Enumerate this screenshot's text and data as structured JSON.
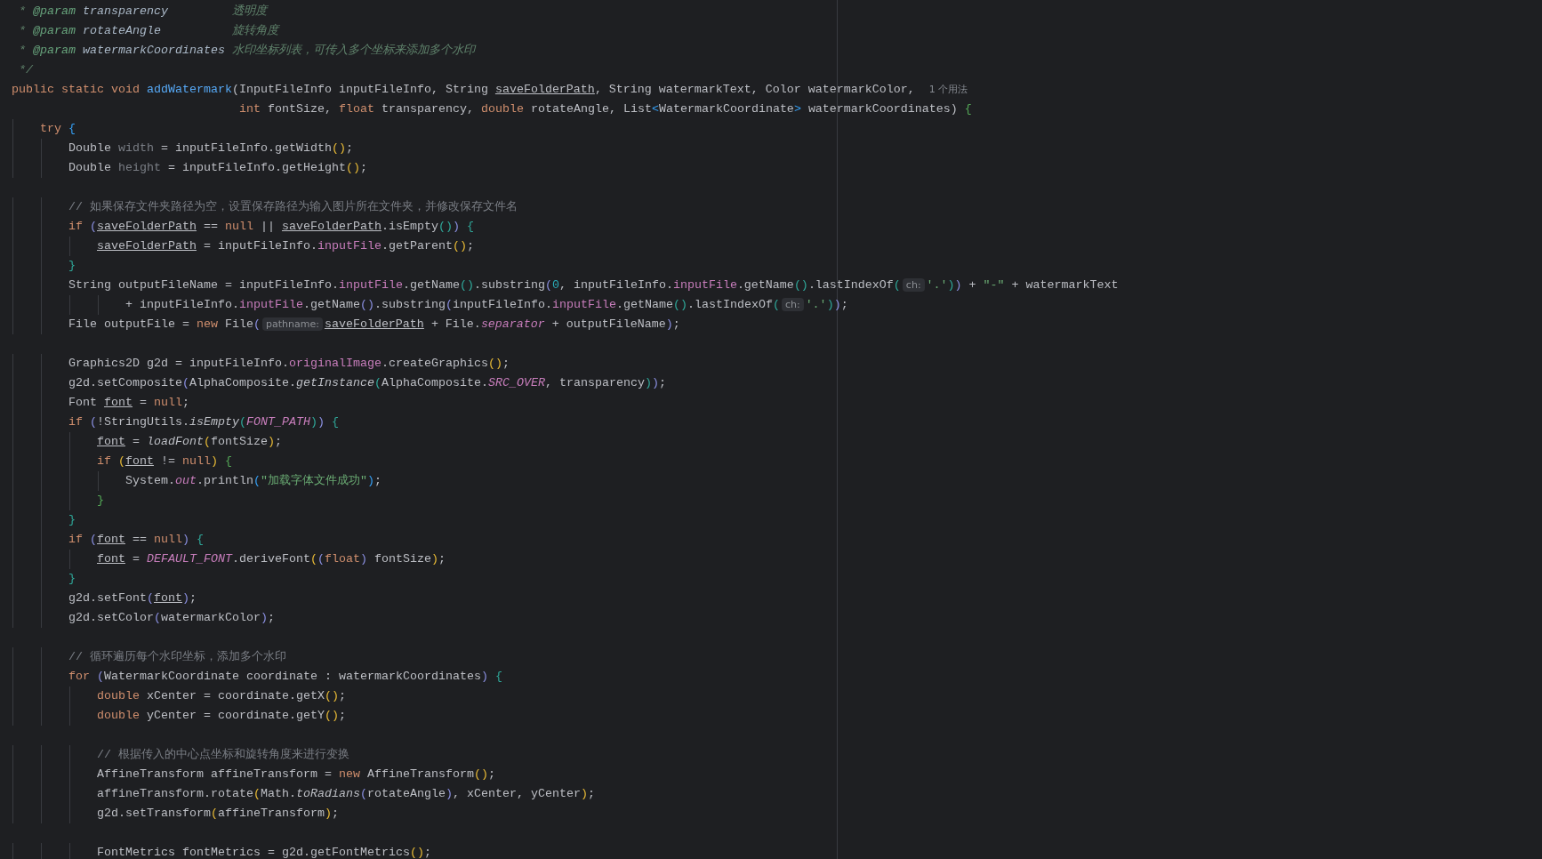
{
  "editor": {
    "lines": [
      {
        "tokens": [
          {
            "kind": "doc",
            "text": " * "
          },
          {
            "kind": "dtag",
            "text": "@param"
          },
          {
            "kind": "dparam",
            "text": " transparency         "
          },
          {
            "kind": "doc",
            "text": "透明度"
          }
        ]
      },
      {
        "tokens": [
          {
            "kind": "doc",
            "text": " * "
          },
          {
            "kind": "dtag",
            "text": "@param"
          },
          {
            "kind": "dparam",
            "text": " rotateAngle          "
          },
          {
            "kind": "doc",
            "text": "旋转角度"
          }
        ]
      },
      {
        "tokens": [
          {
            "kind": "doc",
            "text": " * "
          },
          {
            "kind": "dtag",
            "text": "@param"
          },
          {
            "kind": "dparam",
            "text": " watermarkCoordinates "
          },
          {
            "kind": "doc",
            "text": "水印坐标列表，可传入多个坐标来添加多个水印"
          }
        ]
      },
      {
        "tokens": [
          {
            "kind": "doc",
            "text": " */"
          }
        ]
      },
      {
        "tokens": [
          {
            "kind": "kw",
            "text": "public static void "
          },
          {
            "kind": "decl",
            "text": "addWatermark"
          },
          {
            "kind": "p",
            "text": "(InputFileInfo inputFileInfo, String "
          },
          {
            "kind": "ul",
            "text": "saveFolderPath"
          },
          {
            "kind": "p",
            "text": ", String watermarkText, Color watermarkColor,  "
          },
          {
            "kind": "usage",
            "text": "1 个用法"
          }
        ]
      },
      {
        "tokens": [
          {
            "kind": "kw",
            "text": "                                int"
          },
          {
            "kind": "p",
            "text": " fontSize, "
          },
          {
            "kind": "kw",
            "text": "float"
          },
          {
            "kind": "p",
            "text": " transparency, "
          },
          {
            "kind": "kw",
            "text": "double"
          },
          {
            "kind": "p",
            "text": " rotateAngle, List"
          },
          {
            "kind": "br5",
            "text": "<"
          },
          {
            "kind": "p",
            "text": "WatermarkCoordinate"
          },
          {
            "kind": "br5",
            "text": ">"
          },
          {
            "kind": "p",
            "text": " watermarkCoordinates) "
          },
          {
            "kind": "br4",
            "text": "{"
          }
        ]
      },
      {
        "tokens": [
          {
            "kind": "kw",
            "text": "    try "
          },
          {
            "kind": "br5",
            "text": "{"
          }
        ]
      },
      {
        "tokens": [
          {
            "kind": "p",
            "text": "        Double "
          },
          {
            "kind": "unused",
            "text": "width"
          },
          {
            "kind": "p",
            "text": " = inputFileInfo.getWidth"
          },
          {
            "kind": "br1",
            "text": "()"
          },
          {
            "kind": "p",
            "text": ";"
          }
        ]
      },
      {
        "tokens": [
          {
            "kind": "p",
            "text": "        Double "
          },
          {
            "kind": "unused",
            "text": "height"
          },
          {
            "kind": "p",
            "text": " = inputFileInfo.getHeight"
          },
          {
            "kind": "br1",
            "text": "()"
          },
          {
            "kind": "p",
            "text": ";"
          }
        ]
      },
      {
        "blank_before": true,
        "tokens": [
          {
            "kind": "cm",
            "text": "        // 如果保存文件夹路径为空，设置保存路径为输入图片所在文件夹，并修改保存文件名"
          }
        ]
      },
      {
        "tokens": [
          {
            "kind": "kw",
            "text": "        if "
          },
          {
            "kind": "br3",
            "text": "("
          },
          {
            "kind": "ul",
            "text": "saveFolderPath"
          },
          {
            "kind": "p",
            "text": " == "
          },
          {
            "kind": "kw",
            "text": "null"
          },
          {
            "kind": "p",
            "text": " || "
          },
          {
            "kind": "ul",
            "text": "saveFolderPath"
          },
          {
            "kind": "p",
            "text": ".isEmpty"
          },
          {
            "kind": "br2",
            "text": "()"
          },
          {
            "kind": "br3",
            "text": ")"
          },
          {
            "kind": "br2",
            "text": " {"
          }
        ]
      },
      {
        "tokens": [
          {
            "kind": "ul",
            "text": "            saveFolderPath"
          },
          {
            "kind": "p",
            "text": " = inputFileInfo."
          },
          {
            "kind": "fld",
            "text": "inputFile"
          },
          {
            "kind": "p",
            "text": ".getParent"
          },
          {
            "kind": "br1",
            "text": "()"
          },
          {
            "kind": "p",
            "text": ";"
          }
        ]
      },
      {
        "tokens": [
          {
            "kind": "br2",
            "text": "        }"
          }
        ]
      },
      {
        "tokens": [
          {
            "kind": "p",
            "text": "        String outputFileName = inputFileInfo."
          },
          {
            "kind": "fld",
            "text": "inputFile"
          },
          {
            "kind": "p",
            "text": ".getName"
          },
          {
            "kind": "br2",
            "text": "()"
          },
          {
            "kind": "p",
            "text": ".substring"
          },
          {
            "kind": "br3",
            "text": "("
          },
          {
            "kind": "num",
            "text": "0"
          },
          {
            "kind": "p",
            "text": ", inputFileInfo."
          },
          {
            "kind": "fld",
            "text": "inputFile"
          },
          {
            "kind": "p",
            "text": ".getName"
          },
          {
            "kind": "br2",
            "text": "()"
          },
          {
            "kind": "p",
            "text": ".lastIndexOf"
          },
          {
            "kind": "br2",
            "text": "("
          },
          {
            "kind": "hint",
            "text": "ch:"
          },
          {
            "kind": "str",
            "text": "'.'"
          },
          {
            "kind": "br2",
            "text": ")"
          },
          {
            "kind": "br3",
            "text": ")"
          },
          {
            "kind": "p",
            "text": " + "
          },
          {
            "kind": "str",
            "text": "\"-\""
          },
          {
            "kind": "p",
            "text": " + watermarkText"
          }
        ]
      },
      {
        "tokens": [
          {
            "kind": "p",
            "text": "                + inputFileInfo."
          },
          {
            "kind": "fld",
            "text": "inputFile"
          },
          {
            "kind": "p",
            "text": ".getName"
          },
          {
            "kind": "br3",
            "text": "()"
          },
          {
            "kind": "p",
            "text": ".substring"
          },
          {
            "kind": "br3",
            "text": "("
          },
          {
            "kind": "p",
            "text": "inputFileInfo."
          },
          {
            "kind": "fld",
            "text": "inputFile"
          },
          {
            "kind": "p",
            "text": ".getName"
          },
          {
            "kind": "br2",
            "text": "()"
          },
          {
            "kind": "p",
            "text": ".lastIndexOf"
          },
          {
            "kind": "br2",
            "text": "("
          },
          {
            "kind": "hint",
            "text": "ch:"
          },
          {
            "kind": "str",
            "text": "'.'"
          },
          {
            "kind": "br2",
            "text": ")"
          },
          {
            "kind": "br3",
            "text": ")"
          },
          {
            "kind": "p",
            "text": ";"
          }
        ]
      },
      {
        "tokens": [
          {
            "kind": "p",
            "text": "        File outputFile = "
          },
          {
            "kind": "kw",
            "text": "new"
          },
          {
            "kind": "p",
            "text": " File"
          },
          {
            "kind": "br3",
            "text": "("
          },
          {
            "kind": "hint",
            "text": "pathname:"
          },
          {
            "kind": "ul",
            "text": "saveFolderPath"
          },
          {
            "kind": "p",
            "text": " + File."
          },
          {
            "kind": "sfld",
            "text": "separator"
          },
          {
            "kind": "p",
            "text": " + outputFileName"
          },
          {
            "kind": "br3",
            "text": ")"
          },
          {
            "kind": "p",
            "text": ";"
          }
        ]
      },
      {
        "blank_before": true,
        "tokens": [
          {
            "kind": "p",
            "text": "        Graphics2D g2d = inputFileInfo."
          },
          {
            "kind": "fld",
            "text": "originalImage"
          },
          {
            "kind": "p",
            "text": ".createGraphics"
          },
          {
            "kind": "br1",
            "text": "()"
          },
          {
            "kind": "p",
            "text": ";"
          }
        ]
      },
      {
        "tokens": [
          {
            "kind": "p",
            "text": "        g2d.setComposite"
          },
          {
            "kind": "br3",
            "text": "("
          },
          {
            "kind": "p",
            "text": "AlphaComposite."
          },
          {
            "kind": "it",
            "text": "getInstance"
          },
          {
            "kind": "br2",
            "text": "("
          },
          {
            "kind": "p",
            "text": "AlphaComposite."
          },
          {
            "kind": "sfld",
            "text": "SRC_OVER"
          },
          {
            "kind": "p",
            "text": ", transparency"
          },
          {
            "kind": "br2",
            "text": ")"
          },
          {
            "kind": "br3",
            "text": ")"
          },
          {
            "kind": "p",
            "text": ";"
          }
        ]
      },
      {
        "tokens": [
          {
            "kind": "p",
            "text": "        Font "
          },
          {
            "kind": "ul",
            "text": "font"
          },
          {
            "kind": "p",
            "text": " = "
          },
          {
            "kind": "kw",
            "text": "null"
          },
          {
            "kind": "p",
            "text": ";"
          }
        ]
      },
      {
        "tokens": [
          {
            "kind": "kw",
            "text": "        if "
          },
          {
            "kind": "br3",
            "text": "("
          },
          {
            "kind": "p",
            "text": "!StringUtils."
          },
          {
            "kind": "it",
            "text": "isEmpty"
          },
          {
            "kind": "br2",
            "text": "("
          },
          {
            "kind": "sfld",
            "text": "FONT_PATH"
          },
          {
            "kind": "br2",
            "text": ")"
          },
          {
            "kind": "br3",
            "text": ")"
          },
          {
            "kind": "br2",
            "text": " {"
          }
        ]
      },
      {
        "tokens": [
          {
            "kind": "ul",
            "text": "            font"
          },
          {
            "kind": "p",
            "text": " = "
          },
          {
            "kind": "it",
            "text": "loadFont"
          },
          {
            "kind": "br1",
            "text": "("
          },
          {
            "kind": "p",
            "text": "fontSize"
          },
          {
            "kind": "br1",
            "text": ")"
          },
          {
            "kind": "p",
            "text": ";"
          }
        ]
      },
      {
        "tokens": [
          {
            "kind": "kw",
            "text": "            if "
          },
          {
            "kind": "br1",
            "text": "("
          },
          {
            "kind": "ul",
            "text": "font"
          },
          {
            "kind": "p",
            "text": " != "
          },
          {
            "kind": "kw",
            "text": "null"
          },
          {
            "kind": "br1",
            "text": ")"
          },
          {
            "kind": "br4",
            "text": " {"
          }
        ]
      },
      {
        "tokens": [
          {
            "kind": "p",
            "text": "                System."
          },
          {
            "kind": "sfld",
            "text": "out"
          },
          {
            "kind": "p",
            "text": ".println"
          },
          {
            "kind": "br5",
            "text": "("
          },
          {
            "kind": "str",
            "text": "\"加载字体文件成功\""
          },
          {
            "kind": "br5",
            "text": ")"
          },
          {
            "kind": "p",
            "text": ";"
          }
        ]
      },
      {
        "tokens": [
          {
            "kind": "br4",
            "text": "            }"
          }
        ]
      },
      {
        "tokens": [
          {
            "kind": "br2",
            "text": "        }"
          }
        ]
      },
      {
        "tokens": [
          {
            "kind": "kw",
            "text": "        if "
          },
          {
            "kind": "br3",
            "text": "("
          },
          {
            "kind": "ul",
            "text": "font"
          },
          {
            "kind": "p",
            "text": " == "
          },
          {
            "kind": "kw",
            "text": "null"
          },
          {
            "kind": "br3",
            "text": ")"
          },
          {
            "kind": "br2",
            "text": " {"
          }
        ]
      },
      {
        "tokens": [
          {
            "kind": "ul",
            "text": "            font"
          },
          {
            "kind": "p",
            "text": " = "
          },
          {
            "kind": "sfld",
            "text": "DEFAULT_FONT"
          },
          {
            "kind": "p",
            "text": ".deriveFont"
          },
          {
            "kind": "br1",
            "text": "("
          },
          {
            "kind": "br3",
            "text": "("
          },
          {
            "kind": "kw",
            "text": "float"
          },
          {
            "kind": "br3",
            "text": ")"
          },
          {
            "kind": "p",
            "text": " fontSize"
          },
          {
            "kind": "br1",
            "text": ")"
          },
          {
            "kind": "p",
            "text": ";"
          }
        ]
      },
      {
        "tokens": [
          {
            "kind": "br2",
            "text": "        }"
          }
        ]
      },
      {
        "tokens": [
          {
            "kind": "p",
            "text": "        g2d.setFont"
          },
          {
            "kind": "br3",
            "text": "("
          },
          {
            "kind": "ul",
            "text": "font"
          },
          {
            "kind": "br3",
            "text": ")"
          },
          {
            "kind": "p",
            "text": ";"
          }
        ]
      },
      {
        "tokens": [
          {
            "kind": "p",
            "text": "        g2d.setColor"
          },
          {
            "kind": "br3",
            "text": "("
          },
          {
            "kind": "p",
            "text": "watermarkColor"
          },
          {
            "kind": "br3",
            "text": ")"
          },
          {
            "kind": "p",
            "text": ";"
          }
        ]
      },
      {
        "blank_before": true,
        "tokens": [
          {
            "kind": "cm",
            "text": "        // 循环遍历每个水印坐标，添加多个水印"
          }
        ]
      },
      {
        "tokens": [
          {
            "kind": "kw",
            "text": "        for "
          },
          {
            "kind": "br3",
            "text": "("
          },
          {
            "kind": "p",
            "text": "WatermarkCoordinate coordinate : watermarkCoordinates"
          },
          {
            "kind": "br3",
            "text": ")"
          },
          {
            "kind": "br2",
            "text": " {"
          }
        ]
      },
      {
        "tokens": [
          {
            "kind": "kw",
            "text": "            double"
          },
          {
            "kind": "p",
            "text": " xCenter = coordinate.getX"
          },
          {
            "kind": "br1",
            "text": "()"
          },
          {
            "kind": "p",
            "text": ";"
          }
        ]
      },
      {
        "tokens": [
          {
            "kind": "kw",
            "text": "            double"
          },
          {
            "kind": "p",
            "text": " yCenter = coordinate.getY"
          },
          {
            "kind": "br1",
            "text": "()"
          },
          {
            "kind": "p",
            "text": ";"
          }
        ]
      },
      {
        "blank_before": true,
        "tokens": [
          {
            "kind": "cm",
            "text": "            // 根据传入的中心点坐标和旋转角度来进行变换"
          }
        ]
      },
      {
        "tokens": [
          {
            "kind": "p",
            "text": "            AffineTransform affineTransform = "
          },
          {
            "kind": "kw",
            "text": "new"
          },
          {
            "kind": "p",
            "text": " AffineTransform"
          },
          {
            "kind": "br1",
            "text": "()"
          },
          {
            "kind": "p",
            "text": ";"
          }
        ]
      },
      {
        "tokens": [
          {
            "kind": "p",
            "text": "            affineTransform.rotate"
          },
          {
            "kind": "br1",
            "text": "("
          },
          {
            "kind": "p",
            "text": "Math."
          },
          {
            "kind": "it",
            "text": "toRadians"
          },
          {
            "kind": "br3",
            "text": "("
          },
          {
            "kind": "p",
            "text": "rotateAngle"
          },
          {
            "kind": "br3",
            "text": ")"
          },
          {
            "kind": "p",
            "text": ", xCenter, yCenter"
          },
          {
            "kind": "br1",
            "text": ")"
          },
          {
            "kind": "p",
            "text": ";"
          }
        ]
      },
      {
        "tokens": [
          {
            "kind": "p",
            "text": "            g2d.setTransform"
          },
          {
            "kind": "br1",
            "text": "("
          },
          {
            "kind": "p",
            "text": "affineTransform"
          },
          {
            "kind": "br1",
            "text": ")"
          },
          {
            "kind": "p",
            "text": ";"
          }
        ]
      },
      {
        "blank_before": true,
        "tokens": [
          {
            "kind": "p",
            "text": "            FontMetrics fontMetrics = g2d.getFontMetrics"
          },
          {
            "kind": "br1",
            "text": "()"
          },
          {
            "kind": "p",
            "text": ";"
          }
        ]
      }
    ]
  }
}
